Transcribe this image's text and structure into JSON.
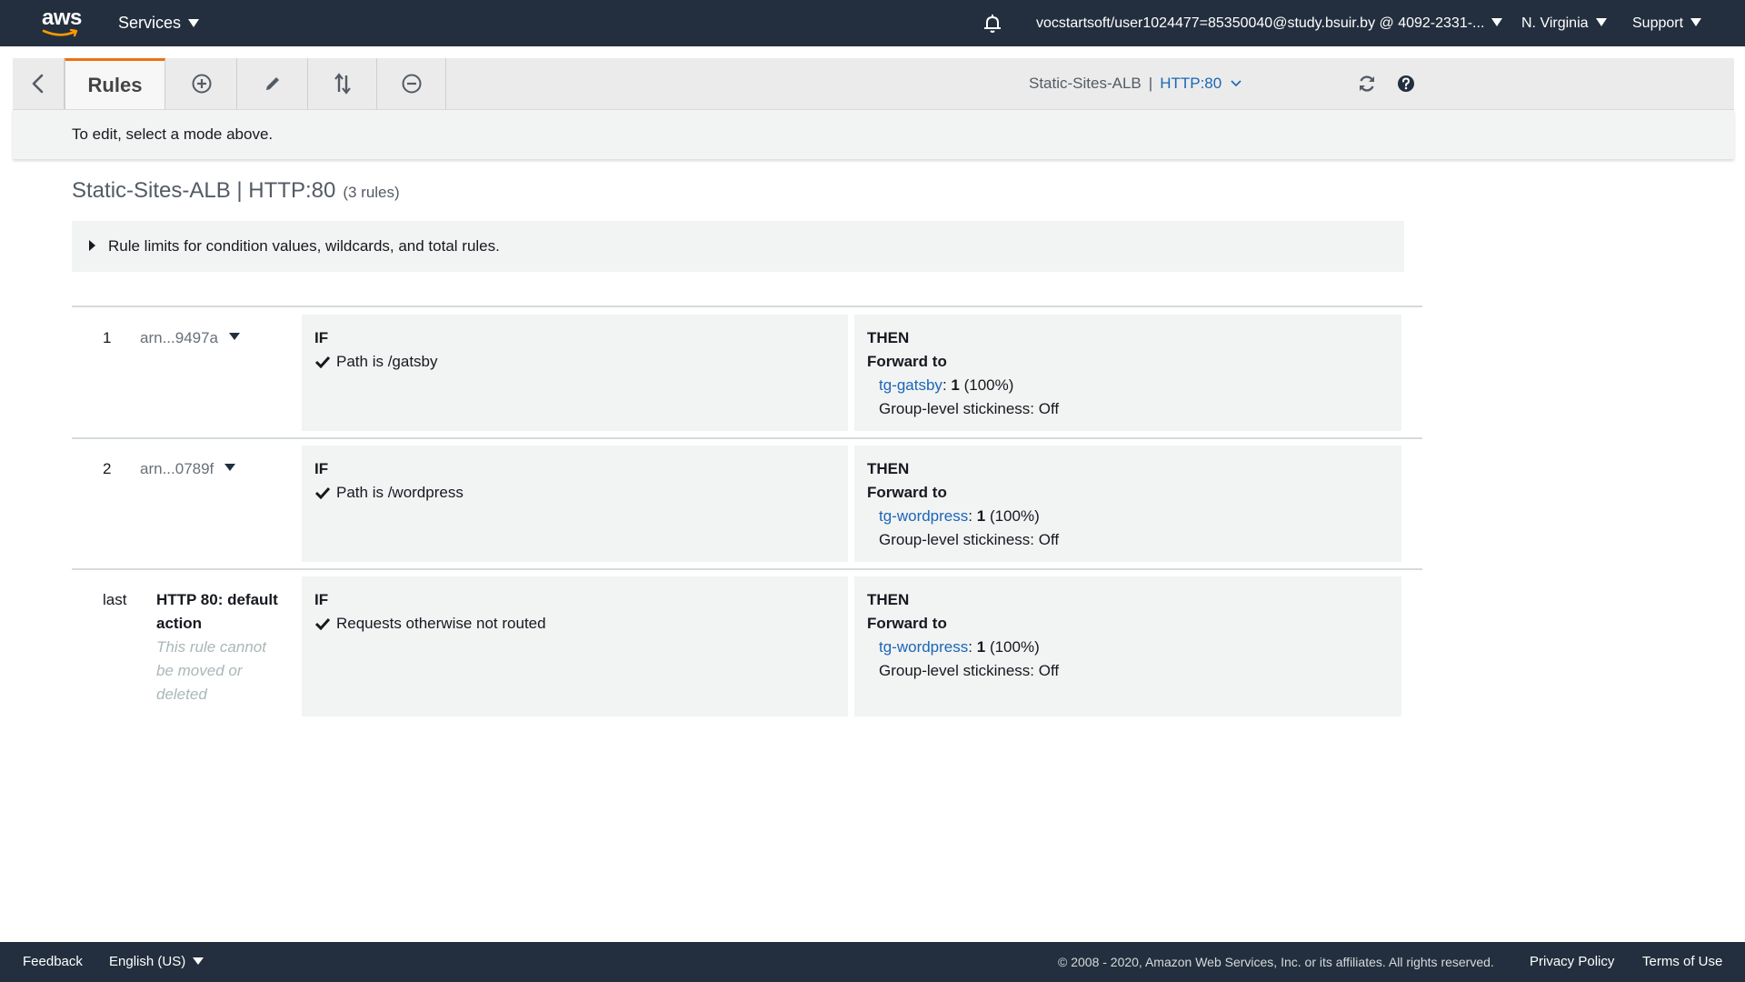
{
  "topnav": {
    "logo_text": "aws",
    "services_label": "Services",
    "account_label": "vocstartsoft/user1024477=85350040@study.bsuir.by @ 4092-2331-...",
    "region_label": "N. Virginia",
    "support_label": "Support",
    "bell_icon": "bell-icon"
  },
  "toolbar": {
    "rules_tab_label": "Rules",
    "icons": [
      "back-chevron-icon",
      "add-circle-icon",
      "pencil-icon",
      "reorder-arrows-icon",
      "remove-circle-icon",
      "refresh-icon",
      "help-icon"
    ],
    "load_balancer": "Static-Sites-ALB",
    "separator": "|",
    "listener": "HTTP:80",
    "hint": "To edit, select a mode above."
  },
  "page": {
    "title": "Static-Sites-ALB | HTTP:80",
    "rule_count": "(3 rules)",
    "limits_label": "Rule limits for condition values, wildcards, and total rules."
  },
  "rules": [
    {
      "number": "1",
      "arn": "arn...9497a",
      "if_label": "IF",
      "condition": "Path is /gatsby",
      "then_label": "THEN",
      "action": "Forward to",
      "target_group": "tg-gatsby",
      "weight_sep": ":",
      "weight": "1",
      "percent": "(100%)",
      "stickiness": "Group-level stickiness: Off"
    },
    {
      "number": "2",
      "arn": "arn...0789f",
      "if_label": "IF",
      "condition": "Path is /wordpress",
      "then_label": "THEN",
      "action": "Forward to",
      "target_group": "tg-wordpress",
      "weight_sep": ":",
      "weight": "1",
      "percent": "(100%)",
      "stickiness": "Group-level stickiness: Off"
    },
    {
      "number": "last",
      "name": "HTTP 80: default action",
      "note": "This rule cannot be moved or deleted",
      "if_label": "IF",
      "condition": "Requests otherwise not routed",
      "then_label": "THEN",
      "action": "Forward to",
      "target_group": "tg-wordpress",
      "weight_sep": ":",
      "weight": "1",
      "percent": "(100%)",
      "stickiness": "Group-level stickiness: Off"
    }
  ],
  "footer": {
    "feedback": "Feedback",
    "language": "English (US)",
    "copyright": "© 2008 - 2020, Amazon Web Services, Inc. or its affiliates. All rights reserved.",
    "privacy": "Privacy Policy",
    "terms": "Terms of Use"
  },
  "colors": {
    "nav_bg": "#232f3e",
    "accent_tab": "#ec7211",
    "link": "#1b66b7",
    "panel_bg": "#f2f3f3"
  }
}
